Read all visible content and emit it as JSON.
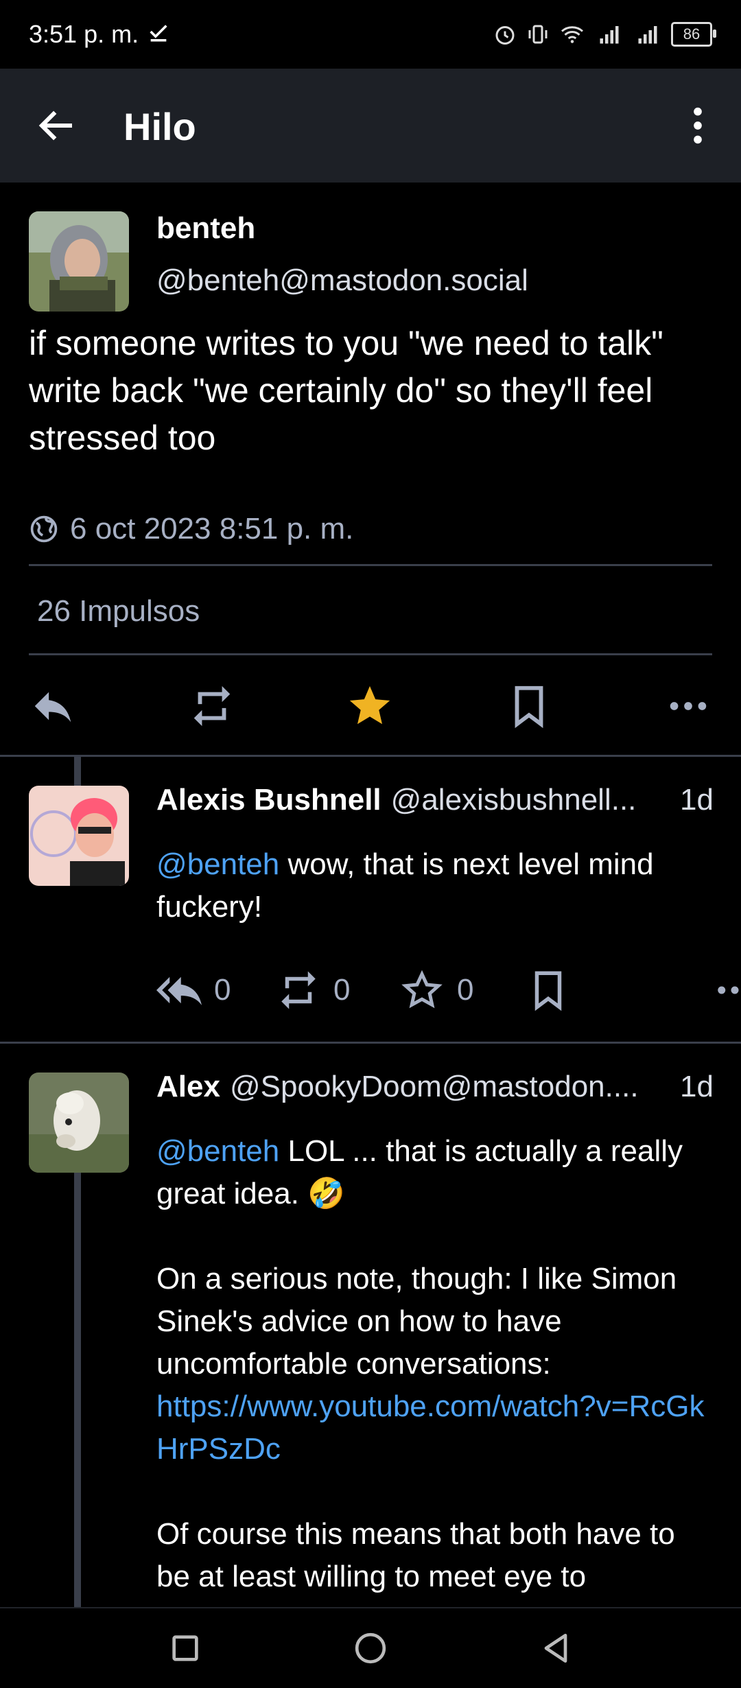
{
  "status_bar": {
    "time": "3:51 p. m.",
    "battery": "86"
  },
  "app_bar": {
    "title": "Hilo"
  },
  "main_post": {
    "display_name": "benteh",
    "handle": "@benteh@mastodon.social",
    "text": "if someone writes to you \"we need to talk\" write back \"we certainly do\" so they'll feel stressed too",
    "timestamp": "6 oct 2023 8:51 p. m.",
    "boost_count_label": "26 Impulsos",
    "favourited": true,
    "colors": {
      "star": "#f0b323",
      "accent": "#4ea2f5"
    }
  },
  "replies": [
    {
      "display_name": "Alexis Bushnell",
      "handle": "@alexisbushnell...",
      "time": "1d",
      "mention": "@benteh",
      "text": " wow, that is next level mind fuckery!",
      "reply_count": "0",
      "boost_count": "0",
      "fav_count": "0"
    },
    {
      "display_name": "Alex",
      "handle": "@SpookyDoom@mastodon....",
      "time": "1d",
      "mention": "@benteh",
      "text_1": " LOL ... that is actually a really great idea. 🤣",
      "text_2": "On a serious note, though: I like Simon Sinek's advice on how to have uncomfortable conversations:",
      "link": "https://www.youtube.com/watch?v=RcGkHrPSzDc",
      "text_3": "Of course this means that both have to be at least willing to meet eye to"
    }
  ]
}
